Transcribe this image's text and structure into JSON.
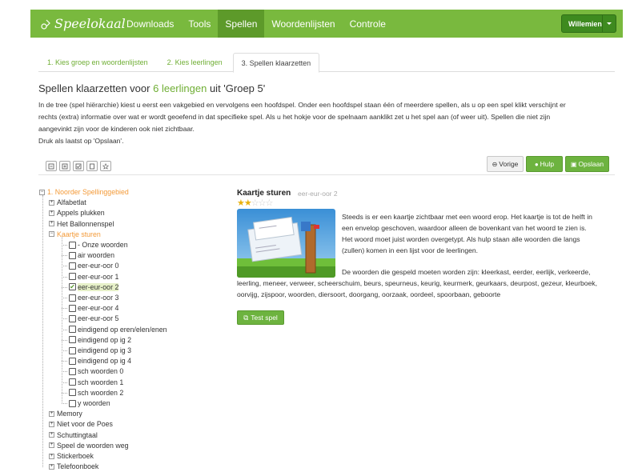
{
  "app": {
    "logo_text": "Speelokaal",
    "brand_color": "#79b93e"
  },
  "nav": {
    "items": [
      {
        "label": "Downloads"
      },
      {
        "label": "Tools"
      },
      {
        "label": "Spellen"
      },
      {
        "label": "Woordenlijsten"
      },
      {
        "label": "Controle"
      }
    ],
    "active_label": "Spellen",
    "user_label": "Willemien"
  },
  "wizard": {
    "tabs": [
      {
        "label": "1. Kies groep en woordenlijsten"
      },
      {
        "label": "2. Kies leerlingen"
      },
      {
        "label": "3. Spellen klaarzetten"
      }
    ],
    "active_tab": "3. Spellen klaarzetten"
  },
  "page": {
    "title_pre": "Spellen klaarzetten voor",
    "title_count": "6 leerlingen",
    "title_mid": "uit 'Groep 5'",
    "intro_lines": [
      "In de tree (spel hiërarchie) kiest u eerst een vakgebied en vervolgens een hoofdspel. Onder een hoofdspel staan één of meerdere spellen, als u op een spel klikt verschijnt er",
      "rechts (extra) informatie over  wat er wordt geoefend in dat specifieke spel. Als u het hokje voor de spelnaam aanklikt zet u het spel aan (of weer uit). Spellen die niet zijn",
      "aangevinkt zijn voor de kinderen ook niet zichtbaar.",
      "Druk als laatst op 'Opslaan'."
    ]
  },
  "toolbar": {
    "icons": [
      "collapse-icon",
      "expand-icon",
      "check-all-icon",
      "uncheck-icon",
      "star-icon"
    ],
    "vorige_label": "Vorige",
    "hulp_label": "Hulp",
    "opslaan_label": "Opslaan"
  },
  "tree": {
    "root_label": "1. Noorder Spellinggebied",
    "top_games_before": [
      "Alfabetlat",
      "Appels plukken",
      "Het Ballonnenspel"
    ],
    "open_game": "Kaartje sturen",
    "sub_games": [
      {
        "label": "- Onze woorden",
        "checked": false
      },
      {
        "label": "air woorden",
        "checked": false
      },
      {
        "label": "eer-eur-oor 0",
        "checked": false
      },
      {
        "label": "eer-eur-oor 1",
        "checked": false
      },
      {
        "label": "eer-eur-oor 2",
        "checked": true
      },
      {
        "label": "eer-eur-oor 3",
        "checked": false
      },
      {
        "label": "eer-eur-oor 4",
        "checked": false
      },
      {
        "label": "eer-eur-oor 5",
        "checked": false
      },
      {
        "label": "eindigend op eren/elen/enen",
        "checked": false
      },
      {
        "label": "eindigend op ig 2",
        "checked": false
      },
      {
        "label": "eindigend op ig 3",
        "checked": false
      },
      {
        "label": "eindigend op ig 4",
        "checked": false
      },
      {
        "label": "sch woorden 0",
        "checked": false
      },
      {
        "label": "sch woorden 1",
        "checked": false
      },
      {
        "label": "sch woorden 2",
        "checked": false
      },
      {
        "label": "y woorden",
        "checked": false
      }
    ],
    "top_games_after": [
      "Memory",
      "Niet voor de Poes",
      "Schuttingtaal",
      "Speel de woorden weg",
      "Stickerboek",
      "Telefoonboek"
    ]
  },
  "detail": {
    "title": "Kaartje sturen",
    "subtitle": "eer-eur-oor 2",
    "rating": 2,
    "rating_max": 5,
    "description_lines": [
      "Steeds is er een kaartje zichtbaar met een woord erop. Het kaartje is tot de helft in",
      "een envelop geschoven, waardoor alleen de bovenkant van het woord te zien is.",
      "Het woord moet juist worden overgetypt. Als hulp staan alle woorden die langs",
      "(zullen) komen in een lijst voor de leerlingen."
    ],
    "words_text": "De woorden die gespeld moeten worden zijn: kleerkast, eerder, eerlijk, verkeerde, leerling, meneer, verweer, scheerschuim, beurs, speurneus, keurig, keurmerk, geurkaars, deurpost, gezeur, kleurboek, oorvijg, zijspoor, woorden, diersoort, doorgang, oorzaak, oordeel, spoorbaan, geboorte",
    "test_label": "Test spel"
  }
}
